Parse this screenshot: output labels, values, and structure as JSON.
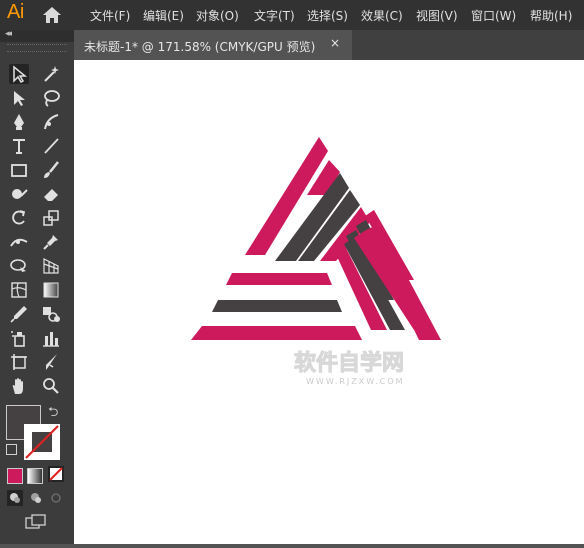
{
  "app": {
    "logo": "Ai",
    "home_icon": "home-icon",
    "accent": "#ff9a00"
  },
  "menu": [
    {
      "label": "文件(F)"
    },
    {
      "label": "编辑(E)"
    },
    {
      "label": "对象(O)"
    },
    {
      "label": "文字(T)"
    },
    {
      "label": "选择(S)"
    },
    {
      "label": "效果(C)"
    },
    {
      "label": "视图(V)"
    },
    {
      "label": "窗口(W)"
    },
    {
      "label": "帮助(H)"
    }
  ],
  "document_tab": {
    "title": "未标题-1* @ 171.58% (CMYK/GPU 预览)",
    "close": "×"
  },
  "tools": [
    {
      "left": "selection-tool-icon",
      "right": "magic-wand-icon"
    },
    {
      "left": "direct-selection-icon",
      "right": "lasso-icon"
    },
    {
      "left": "pen-icon",
      "right": "curvature-icon"
    },
    {
      "left": "type-icon",
      "right": "line-segment-icon"
    },
    {
      "left": "rectangle-icon",
      "right": "paintbrush-icon"
    },
    {
      "left": "shaper-icon",
      "right": "eraser-icon"
    },
    {
      "left": "rotate-icon",
      "right": "scale-icon"
    },
    {
      "left": "width-icon",
      "right": "puppet-warp-icon"
    },
    {
      "left": "shape-builder-icon",
      "right": "perspective-grid-icon"
    },
    {
      "left": "mesh-icon",
      "right": "gradient-icon"
    },
    {
      "left": "eyedropper-icon",
      "right": "blend-icon"
    },
    {
      "left": "symbol-sprayer-icon",
      "right": "column-graph-icon"
    },
    {
      "left": "artboard-icon",
      "right": "slice-icon"
    },
    {
      "left": "hand-icon",
      "right": "zoom-icon"
    }
  ],
  "colors": {
    "fill": "#454142",
    "stroke": "none",
    "artwork_pink": "#cc1a5c",
    "artwork_dark": "#454142"
  },
  "watermark": {
    "main": "软件自学网",
    "sub": "WWW.RJZXW.COM"
  }
}
